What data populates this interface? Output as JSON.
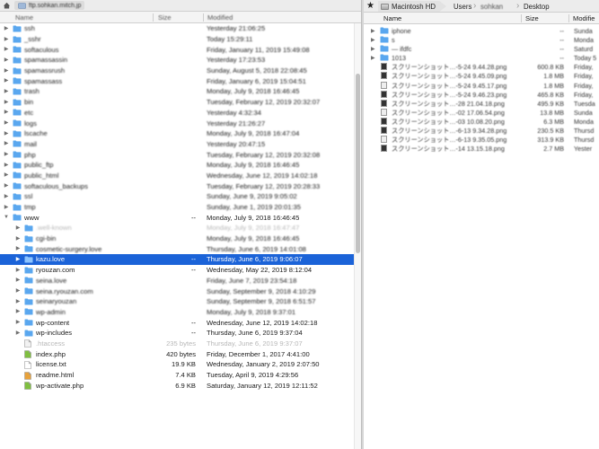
{
  "left": {
    "path_host": "ftp.sohkan.mitch.jp",
    "columns": {
      "name": "Name",
      "size": "Size",
      "modified": "Modified"
    },
    "rows": [
      {
        "indent": 0,
        "expanded": false,
        "type": "folder",
        "name": "ssh",
        "size": "",
        "modified": "Yesterday 21:06:25",
        "blur": true
      },
      {
        "indent": 0,
        "expanded": false,
        "type": "folder",
        "name": "_sshr",
        "size": "",
        "modified": "Today 15:29:11",
        "blur": true
      },
      {
        "indent": 0,
        "expanded": false,
        "type": "folder",
        "name": "softaculous",
        "size": "",
        "modified": "Friday, January 11, 2019 15:49:08",
        "blur": true
      },
      {
        "indent": 0,
        "expanded": false,
        "type": "folder",
        "name": "spamassassin",
        "size": "",
        "modified": "Yesterday 17:23:53",
        "blur": true
      },
      {
        "indent": 0,
        "expanded": false,
        "type": "folder",
        "name": "spamassrush",
        "size": "",
        "modified": "Sunday, August 5, 2018 22:08:45",
        "blur": true
      },
      {
        "indent": 0,
        "expanded": false,
        "type": "folder",
        "name": "spamassass",
        "size": "",
        "modified": "Friday, January 6, 2019 15:04:51",
        "blur": true
      },
      {
        "indent": 0,
        "expanded": false,
        "type": "folder",
        "name": "trash",
        "size": "",
        "modified": "Monday, July 9, 2018 16:46:45",
        "blur": true
      },
      {
        "indent": 0,
        "expanded": false,
        "type": "folder",
        "name": "bin",
        "size": "",
        "modified": "Tuesday, February 12, 2019 20:32:07",
        "blur": true
      },
      {
        "indent": 0,
        "expanded": false,
        "type": "folder",
        "name": "etc",
        "size": "",
        "modified": "Yesterday 4:32:34",
        "blur": true
      },
      {
        "indent": 0,
        "expanded": false,
        "type": "folder",
        "name": "logs",
        "size": "",
        "modified": "Yesterday 21:26:27",
        "blur": true
      },
      {
        "indent": 0,
        "expanded": false,
        "type": "folder",
        "name": "lscache",
        "size": "",
        "modified": "Monday, July 9, 2018 16:47:04",
        "blur": true
      },
      {
        "indent": 0,
        "expanded": false,
        "type": "folder",
        "name": "mail",
        "size": "",
        "modified": "Yesterday 20:47:15",
        "blur": true
      },
      {
        "indent": 0,
        "expanded": false,
        "type": "folder",
        "name": "php",
        "size": "",
        "modified": "Tuesday, February 12, 2019 20:32:08",
        "blur": true
      },
      {
        "indent": 0,
        "expanded": false,
        "type": "folder",
        "name": "public_ftp",
        "size": "",
        "modified": "Monday, July 9, 2018 16:46:45",
        "blur": true
      },
      {
        "indent": 0,
        "expanded": false,
        "type": "folder",
        "name": "public_html",
        "size": "",
        "modified": "Wednesday, June 12, 2019 14:02:18",
        "blur": true
      },
      {
        "indent": 0,
        "expanded": false,
        "type": "folder",
        "name": "softaculous_backups",
        "size": "",
        "modified": "Tuesday, February 12, 2019 20:28:33",
        "blur": true
      },
      {
        "indent": 0,
        "expanded": false,
        "type": "folder",
        "name": "ssl",
        "size": "",
        "modified": "Sunday, June 9, 2019 9:05:02",
        "blur": true
      },
      {
        "indent": 0,
        "expanded": false,
        "type": "folder",
        "name": "tmp",
        "size": "",
        "modified": "Sunday, June 1, 2019 20:01:35",
        "blur": true
      },
      {
        "indent": 0,
        "expanded": true,
        "type": "folder",
        "name": "www",
        "size": "--",
        "modified": "Monday, July 9, 2018 16:46:45",
        "blur": false
      },
      {
        "indent": 1,
        "expanded": false,
        "type": "folder",
        "name": ".well-known",
        "size": "",
        "modified": "Monday, July 9, 2018 16:47:47",
        "blur": true,
        "dim": true
      },
      {
        "indent": 1,
        "expanded": false,
        "type": "folder",
        "name": "cgi-bin",
        "size": "",
        "modified": "Monday, July 9, 2018 16:46:45",
        "blur": true
      },
      {
        "indent": 1,
        "expanded": false,
        "type": "folder",
        "name": "cosmetic-surgery.love",
        "size": "",
        "modified": "Thursday, June 6, 2019 14:01:08",
        "blur": true
      },
      {
        "indent": 1,
        "expanded": false,
        "type": "folder",
        "name": "kazu.love",
        "size": "--",
        "modified": "Thursday, June 6, 2019 9:06:07",
        "blur": false,
        "selected": true
      },
      {
        "indent": 1,
        "expanded": false,
        "type": "folder",
        "name": "ryouzan.com",
        "size": "--",
        "modified": "Wednesday, May 22, 2019 8:12:04",
        "blur": false
      },
      {
        "indent": 1,
        "expanded": false,
        "type": "folder",
        "name": "seina.love",
        "size": "",
        "modified": "Friday, June 7, 2019 23:54:18",
        "blur": true
      },
      {
        "indent": 1,
        "expanded": false,
        "type": "folder",
        "name": "seina.ryouzan.com",
        "size": "",
        "modified": "Sunday, September 9, 2018 4:10:29",
        "blur": true
      },
      {
        "indent": 1,
        "expanded": false,
        "type": "folder",
        "name": "seinaryouzan",
        "size": "",
        "modified": "Sunday, September 9, 2018 6:51:57",
        "blur": true
      },
      {
        "indent": 1,
        "expanded": false,
        "type": "folder",
        "name": "wp-admin",
        "size": "",
        "modified": "Monday, July 9, 2018 9:37:01",
        "blur": true
      },
      {
        "indent": 1,
        "expanded": false,
        "type": "folder",
        "name": "wp-content",
        "size": "--",
        "modified": "Wednesday, June 12, 2019 14:02:18",
        "blur": false
      },
      {
        "indent": 1,
        "expanded": false,
        "type": "folder",
        "name": "wp-includes",
        "size": "--",
        "modified": "Thursday, June 6, 2019 9:37:04",
        "blur": false
      },
      {
        "indent": 1,
        "expanded": false,
        "type": "file-plain",
        "name": ".htaccess",
        "size": "235 bytes",
        "modified": "Thursday, June 6, 2019 9:37:07",
        "blur": false,
        "dim": true
      },
      {
        "indent": 1,
        "expanded": false,
        "type": "file-php",
        "name": "index.php",
        "size": "420 bytes",
        "modified": "Friday, December 1, 2017 4:41:00",
        "blur": false
      },
      {
        "indent": 1,
        "expanded": false,
        "type": "file-txt",
        "name": "license.txt",
        "size": "19.9 KB",
        "modified": "Wednesday, January 2, 2019 2:07:50",
        "blur": false
      },
      {
        "indent": 1,
        "expanded": false,
        "type": "file-html",
        "name": "readme.html",
        "size": "7.4 KB",
        "modified": "Tuesday, April 9, 2019 4:29:56",
        "blur": false
      },
      {
        "indent": 1,
        "expanded": false,
        "type": "file-php",
        "name": "wp-activate.php",
        "size": "6.9 KB",
        "modified": "Saturday, January 12, 2019 12:11:52",
        "blur": false
      }
    ]
  },
  "right": {
    "breadcrumbs": [
      "Macintosh HD",
      "Users",
      "sohkan",
      "Desktop"
    ],
    "columns": {
      "name": "Name",
      "size": "Size",
      "modified": "Modifie"
    },
    "rows": [
      {
        "type": "folder",
        "name": "iphone",
        "size": "--",
        "modified": "Sunda"
      },
      {
        "type": "folder",
        "name": "s",
        "size": "--",
        "modified": "Monda"
      },
      {
        "type": "folder",
        "name": "— ifdfc",
        "size": "--",
        "modified": "Saturd"
      },
      {
        "type": "folder",
        "name": "1013",
        "size": "--",
        "modified": "Today 5"
      },
      {
        "type": "image",
        "name": "スクリーンショット…-5-24 9.44.28.png",
        "size": "600.8 KB",
        "modified": "Friday,"
      },
      {
        "type": "image",
        "name": "スクリーンショット…-5-24 9.45.09.png",
        "size": "1.8 MB",
        "modified": "Friday,"
      },
      {
        "type": "image",
        "name": "スクリーンショット…-5-24 9.45.17.png",
        "size": "1.8 MB",
        "modified": "Friday,"
      },
      {
        "type": "image",
        "name": "スクリーンショット…-5-24 9.46.23.png",
        "size": "465.8 KB",
        "modified": "Friday,"
      },
      {
        "type": "image",
        "name": "スクリーンショット…-28 21.04.18.png",
        "size": "495.9 KB",
        "modified": "Tuesda"
      },
      {
        "type": "image",
        "name": "スクリーンショット…-02 17.06.54.png",
        "size": "13.8 MB",
        "modified": "Sunda"
      },
      {
        "type": "image",
        "name": "スクリーンショット…-03 10.08.20.png",
        "size": "6.3 MB",
        "modified": "Monda"
      },
      {
        "type": "image",
        "name": "スクリーンショット…-6-13 9.34.28.png",
        "size": "230.5 KB",
        "modified": "Thursd"
      },
      {
        "type": "image",
        "name": "スクリーンショット…-6-13 9.35.05.png",
        "size": "313.9 KB",
        "modified": "Thursd"
      },
      {
        "type": "image",
        "name": "スクリーンショット…-14 13.15.18.png",
        "size": "2.7 MB",
        "modified": "Yester"
      }
    ]
  },
  "icons": {
    "folder": "folder-icon",
    "disclosure_collapsed": "▶",
    "disclosure_expanded": "▼",
    "star": "★",
    "home": "home-icon"
  },
  "colors": {
    "selection": "#1b63d8",
    "folder": "#5aa7ee"
  }
}
